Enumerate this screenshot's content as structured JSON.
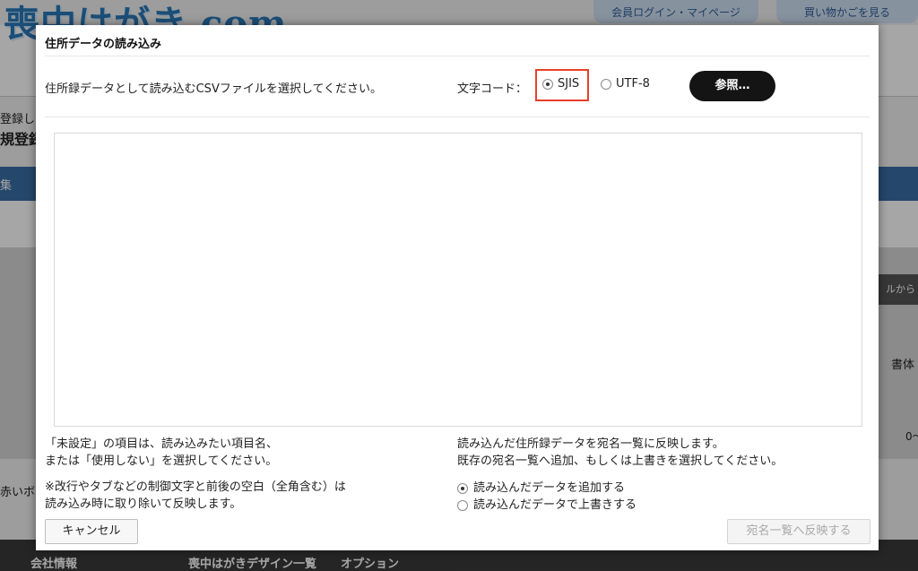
{
  "background": {
    "logo_text": "喪中はがき.com",
    "login_button": "会員ログイン・マイページ",
    "cart_button": "買い物かごを見る",
    "text_line1": "登録し",
    "text_line2": "規登録",
    "bluebar_text": "集",
    "right_tab": "ルから",
    "right_label": "書体",
    "right_number": "0〜",
    "text_line3": "赤いボク",
    "footer_links": [
      "会社情報",
      "喪中はがきデザイン一覧",
      "オプション"
    ]
  },
  "dialog": {
    "title": "住所データの読み込み",
    "instruction": "住所録データとして読み込むCSVファイルを選択してください。",
    "encoding_label": "文字コード：",
    "encoding_options": [
      {
        "label": "SJIS",
        "checked": true
      },
      {
        "label": "UTF-8",
        "checked": false
      }
    ],
    "browse_button": "参照…",
    "note_left": {
      "line1": "「未設定」の項目は、読み込みたい項目名、",
      "line2": "または「使用しない」を選択してください。",
      "line3": "※改行やタブなどの制御文字と前後の空白（全角含む）は",
      "line4": "読み込み時に取り除いて反映します。"
    },
    "note_right": {
      "line1": "読み込んだ住所録データを宛名一覧に反映します。",
      "line2": "既存の宛名一覧へ追加、もしくは上書きを選択してください。"
    },
    "import_options": [
      {
        "label": "読み込んだデータを追加する",
        "checked": true
      },
      {
        "label": "読み込んだデータで上書きする",
        "checked": false
      }
    ],
    "cancel_button": "キャンセル",
    "apply_button": "宛名一覧へ反映する"
  },
  "colors": {
    "highlight": "#e8402a",
    "browse_bg": "#141414",
    "brand_blue": "#2a78b8"
  }
}
